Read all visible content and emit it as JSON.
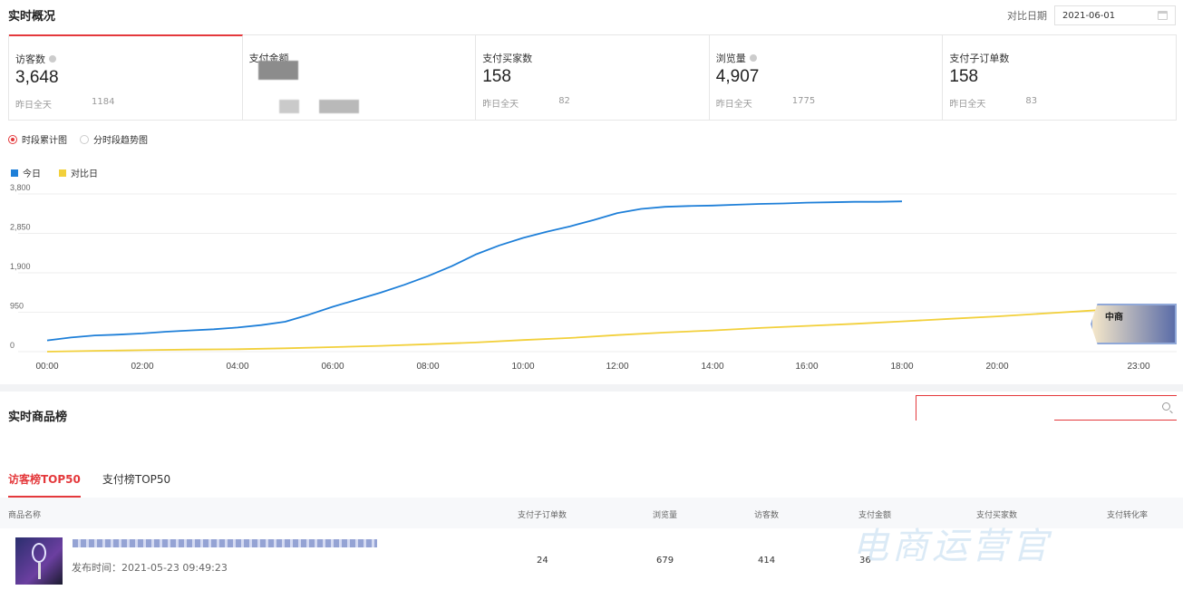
{
  "overview": {
    "title": "实时概况",
    "compare_label": "对比日期",
    "compare_date": "2021-06-01"
  },
  "metrics": [
    {
      "label": "访客数",
      "value": "3,648",
      "sub_label": "昨日全天",
      "sub_value": "1184",
      "info": true,
      "active": true
    },
    {
      "label": "支付金额",
      "value": "",
      "sub_label": "",
      "sub_value": "",
      "info": false,
      "active": false
    },
    {
      "label": "支付买家数",
      "value": "158",
      "sub_label": "昨日全天",
      "sub_value": "82",
      "info": false,
      "active": false
    },
    {
      "label": "浏览量",
      "value": "4,907",
      "sub_label": "昨日全天",
      "sub_value": "1775",
      "info": true,
      "active": false
    },
    {
      "label": "支付子订单数",
      "value": "158",
      "sub_label": "昨日全天",
      "sub_value": "83",
      "info": false,
      "active": false
    }
  ],
  "view_options": {
    "cumulative": "时段累计图",
    "trend": "分时段趋势图",
    "selected": "cumulative"
  },
  "chart_data": {
    "type": "line",
    "y_ticks": [
      "3,800",
      "2,850",
      "1,900",
      "950",
      "0"
    ],
    "x_ticks": [
      "00:00",
      "02:00",
      "04:00",
      "06:00",
      "08:00",
      "10:00",
      "12:00",
      "14:00",
      "16:00",
      "18:00",
      "20:00",
      "23:00"
    ],
    "ylim": [
      0,
      3800
    ],
    "grid": true,
    "legend_position": "top-left",
    "series": [
      {
        "name": "今日",
        "color": "#1e7fd8",
        "x": [
          0,
          0.5,
          1,
          1.5,
          2,
          2.5,
          3,
          3.5,
          4,
          4.5,
          5,
          5.5,
          6,
          6.5,
          7,
          7.5,
          8,
          8.5,
          9,
          9.5,
          10,
          10.5,
          11,
          11.5,
          12,
          12.5,
          13,
          13.5,
          14,
          14.5,
          15,
          15.5,
          16,
          16.5,
          17,
          17.5,
          18
        ],
        "values": [
          270,
          340,
          390,
          410,
          440,
          480,
          510,
          540,
          580,
          640,
          720,
          890,
          1080,
          1250,
          1420,
          1610,
          1820,
          2060,
          2340,
          2560,
          2740,
          2890,
          3020,
          3170,
          3340,
          3440,
          3490,
          3510,
          3520,
          3540,
          3560,
          3570,
          3590,
          3600,
          3610,
          3610,
          3620
        ]
      },
      {
        "name": "对比日",
        "color": "#f2d03b",
        "x": [
          0,
          1,
          2,
          3,
          4,
          5,
          6,
          7,
          8,
          9,
          10,
          11,
          12,
          13,
          14,
          15,
          16,
          17,
          18,
          19,
          20,
          21,
          22,
          23
        ],
        "values": [
          0,
          20,
          35,
          50,
          60,
          80,
          110,
          140,
          180,
          220,
          280,
          330,
          400,
          460,
          510,
          570,
          620,
          670,
          730,
          790,
          850,
          920,
          990,
          1060
        ]
      }
    ]
  },
  "ranking": {
    "title": "实时商品榜",
    "tabs": [
      "访客榜TOP50",
      "支付榜TOP50"
    ],
    "columns": [
      "商品名称",
      "支付子订单数",
      "浏览量",
      "访客数",
      "支付金额",
      "支付买家数",
      "支付转化率"
    ],
    "rows": [
      {
        "time_label": "发布时间：2021-05-23 09:49:23",
        "orders": "24",
        "views": "679",
        "visitors": "414",
        "amount": "36"
      }
    ]
  },
  "watermark": {
    "text": "电商运营官",
    "badge": "中商"
  }
}
